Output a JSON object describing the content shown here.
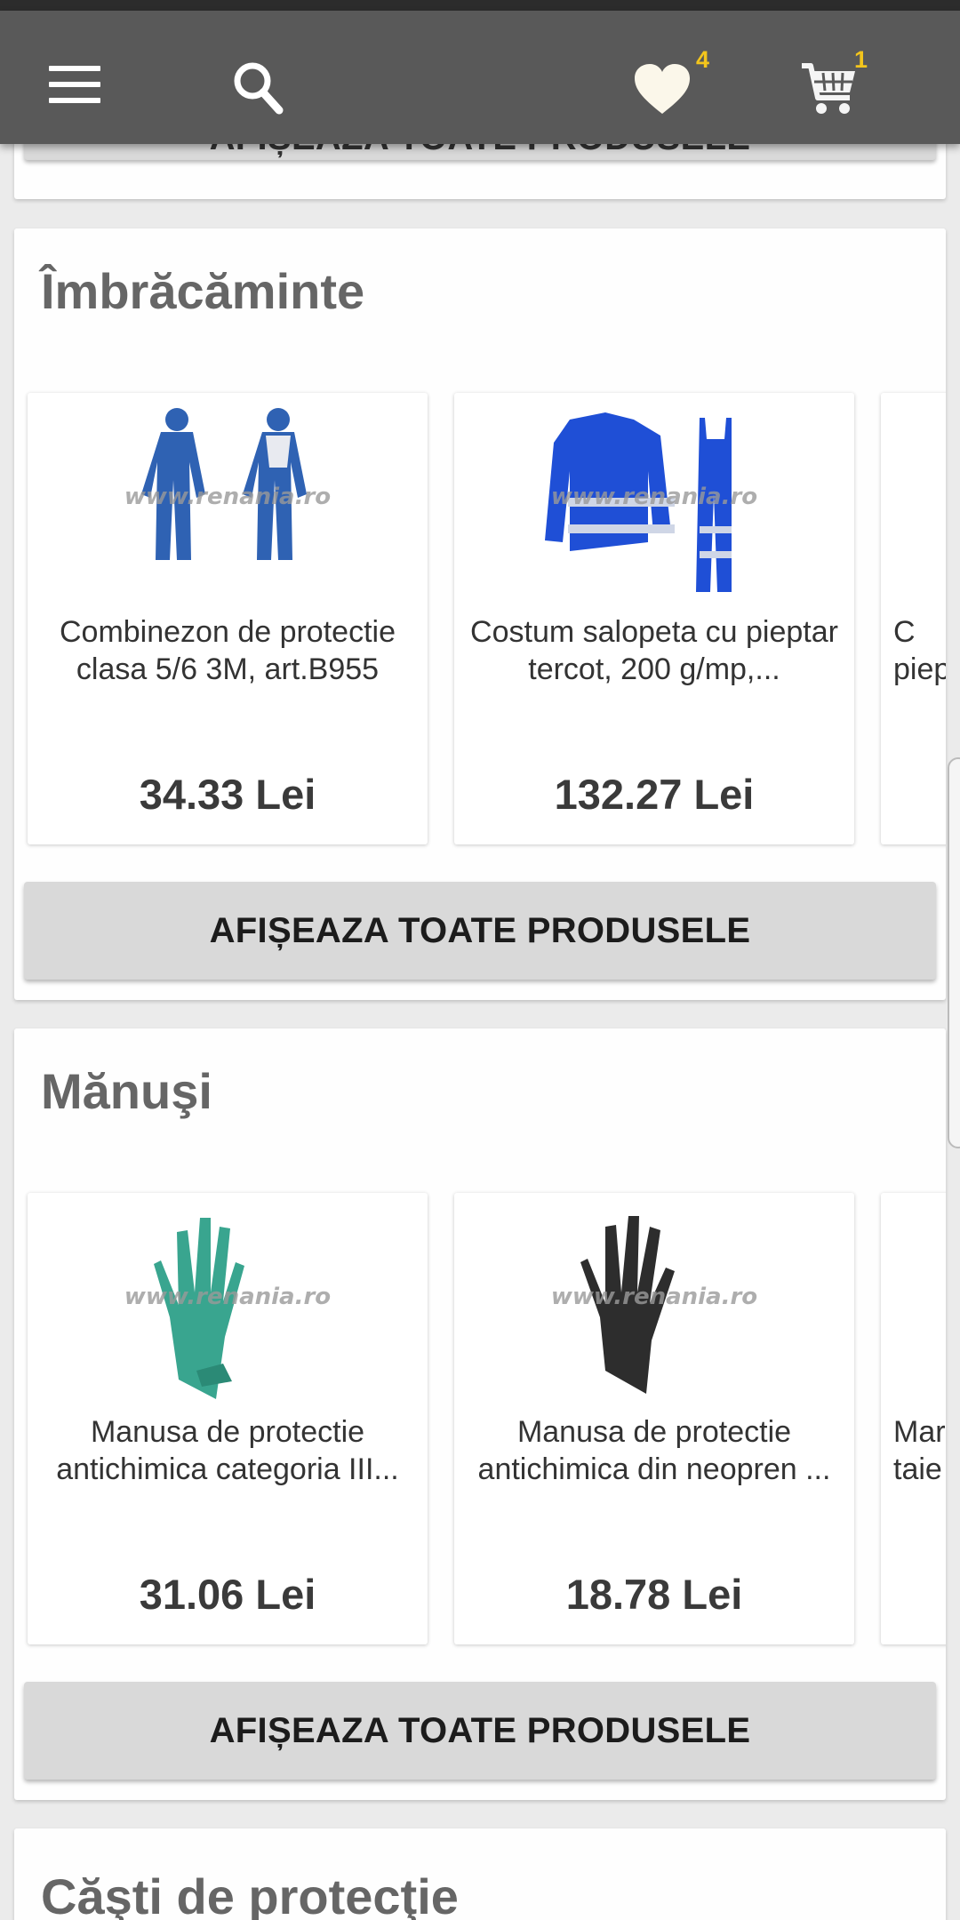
{
  "header": {
    "wishlist_count": "4",
    "cart_count": "1"
  },
  "top_card": {
    "button_label": "AFIȘEAZA TOATE PRODUSELE"
  },
  "categories": [
    {
      "title": "Îmbrăcăminte",
      "products": [
        {
          "name": "Combinezon de protectie clasa 5/6 3M, art.B955",
          "price": "34.33 Lei",
          "image": "coverall-image"
        },
        {
          "name": "Costum salopeta cu pieptar tercot, 200 g/mp,...",
          "price": "132.27 Lei",
          "image": "jacket-overalls-image"
        },
        {
          "name": "C\npiep",
          "price": "",
          "image": ""
        }
      ],
      "button_label": "AFIȘEAZA TOATE PRODUSELE"
    },
    {
      "title": "Mănuşi",
      "products": [
        {
          "name": "Manusa de protectie antichimica categoria III...",
          "price": "31.06 Lei",
          "image": "green-glove-image"
        },
        {
          "name": "Manusa de protectie antichimica din neopren ...",
          "price": "18.78 Lei",
          "image": "black-glove-image"
        },
        {
          "name": "Mar\ntaie",
          "price": "",
          "image": ""
        }
      ],
      "button_label": "AFIȘEAZA TOATE PRODUSELE"
    },
    {
      "title": "Căşti de protecţie"
    }
  ],
  "watermark": "www.renania.ro",
  "colors": {
    "app_bar": "#595959",
    "badge": "#f3c51c",
    "button_bg": "#d9d9d9",
    "page_bg": "#ebebeb"
  }
}
